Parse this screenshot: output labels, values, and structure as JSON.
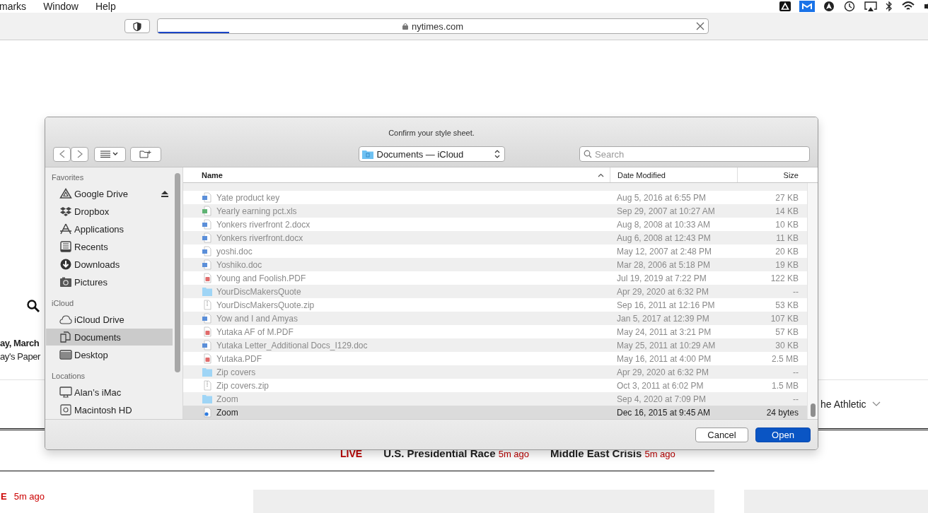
{
  "menu_bar": {
    "items": [
      "marks",
      "Window",
      "Help"
    ]
  },
  "browser": {
    "address": "nytimes.com",
    "loading": {
      "level": 0.13
    }
  },
  "page": {
    "date_line": "ay, March",
    "paper_link": "ay's Paper",
    "athletic_link": "he Athletic",
    "live_label": "LIVE",
    "live_links": [
      {
        "title": "U.S. Presidential Race",
        "time": "5m ago"
      },
      {
        "title": "Middle East Crisis",
        "time": "5m ago"
      }
    ],
    "story_label": "E",
    "story_time": "5m ago"
  },
  "dialog": {
    "title": "Confirm your style sheet.",
    "location": "Documents — iCloud",
    "search": {
      "placeholder": "Search"
    },
    "sidebar": [
      {
        "heading": "Favorites",
        "items": [
          {
            "label": "Google Drive",
            "eject": true,
            "selected": false
          },
          {
            "label": "Dropbox",
            "eject": false,
            "selected": false
          },
          {
            "label": "Applications",
            "eject": false,
            "selected": false
          },
          {
            "label": "Recents",
            "eject": false,
            "selected": false
          },
          {
            "label": "Downloads",
            "eject": false,
            "selected": false
          },
          {
            "label": "Pictures",
            "eject": false,
            "selected": false
          }
        ]
      },
      {
        "heading": "iCloud",
        "items": [
          {
            "label": "iCloud Drive",
            "eject": false,
            "selected": false
          },
          {
            "label": "Documents",
            "eject": false,
            "selected": true
          },
          {
            "label": "Desktop",
            "eject": false,
            "selected": false
          }
        ]
      },
      {
        "heading": "Locations",
        "items": [
          {
            "label": "Alan’s iMac",
            "eject": false,
            "selected": false
          },
          {
            "label": "Macintosh HD",
            "eject": false,
            "selected": false
          }
        ]
      }
    ],
    "columns": [
      {
        "label": "Name",
        "sorted": true
      },
      {
        "label": "Date Modified",
        "sorted": false
      },
      {
        "label": "Size",
        "sorted": false
      }
    ],
    "files": [
      {
        "name": "Yate product key",
        "date": "Aug 5, 2016 at 6:55 PM",
        "size": "27 KB",
        "kind": "word",
        "disabled": true,
        "selected": false
      },
      {
        "name": "Yearly earning pct.xls",
        "date": "Sep 29, 2007 at 10:27 AM",
        "size": "14 KB",
        "kind": "excel",
        "disabled": true,
        "selected": false
      },
      {
        "name": "Yonkers riverfront 2.docx",
        "date": "Aug 8, 2008 at 10:33 AM",
        "size": "10 KB",
        "kind": "word",
        "disabled": true,
        "selected": false
      },
      {
        "name": "Yonkers riverfront.docx",
        "date": "Aug 6, 2008 at 12:43 PM",
        "size": "11 KB",
        "kind": "word",
        "disabled": true,
        "selected": false
      },
      {
        "name": "yoshi.doc",
        "date": "May 12, 2007 at 2:48 PM",
        "size": "20 KB",
        "kind": "word",
        "disabled": true,
        "selected": false
      },
      {
        "name": "Yoshiko.doc",
        "date": "Mar 28, 2006 at 5:18 PM",
        "size": "19 KB",
        "kind": "word",
        "disabled": true,
        "selected": false
      },
      {
        "name": "Young and Foolish.PDF",
        "date": "Jul 19, 2019 at 7:22 PM",
        "size": "122 KB",
        "kind": "pdf",
        "disabled": true,
        "selected": false
      },
      {
        "name": "YourDiscMakersQuote",
        "date": "Apr 29, 2020 at 6:32 PM",
        "size": "--",
        "kind": "folder",
        "disabled": true,
        "selected": false
      },
      {
        "name": "YourDiscMakersQuote.zip",
        "date": "Sep 16, 2011 at 12:16 PM",
        "size": "53 KB",
        "kind": "zip",
        "disabled": true,
        "selected": false
      },
      {
        "name": "Yow and I and Amyas",
        "date": "Jan 5, 2017 at 12:39 PM",
        "size": "107 KB",
        "kind": "word",
        "disabled": true,
        "selected": false
      },
      {
        "name": "Yutaka AF of M.PDF",
        "date": "May 24, 2011 at 3:21 PM",
        "size": "57 KB",
        "kind": "pdf",
        "disabled": true,
        "selected": false
      },
      {
        "name": "Yutaka Letter_Additional Docs_I129.doc",
        "date": "May 25, 2011 at 10:29 AM",
        "size": "30 KB",
        "kind": "word",
        "disabled": true,
        "selected": false
      },
      {
        "name": "Yutaka.PDF",
        "date": "May 16, 2011 at 4:00 PM",
        "size": "2.5 MB",
        "kind": "pdf",
        "disabled": true,
        "selected": false
      },
      {
        "name": "Zip covers",
        "date": "Apr 29, 2020 at 6:32 PM",
        "size": "--",
        "kind": "folder",
        "disabled": true,
        "selected": false
      },
      {
        "name": "Zip covers.zip",
        "date": "Oct 3, 2011 at 6:02 PM",
        "size": "1.5 MB",
        "kind": "zip",
        "disabled": true,
        "selected": false
      },
      {
        "name": "Zoom",
        "date": "Sep 4, 2020 at 7:09 PM",
        "size": "--",
        "kind": "folder",
        "disabled": true,
        "selected": false
      },
      {
        "name": "Zoom",
        "date": "Dec 16, 2015 at 9:45 AM",
        "size": "24 bytes",
        "kind": "zoom",
        "disabled": false,
        "selected": true
      }
    ],
    "buttons": [
      {
        "label": "Cancel",
        "kind": "normal"
      },
      {
        "label": "Open",
        "kind": "default"
      }
    ]
  }
}
